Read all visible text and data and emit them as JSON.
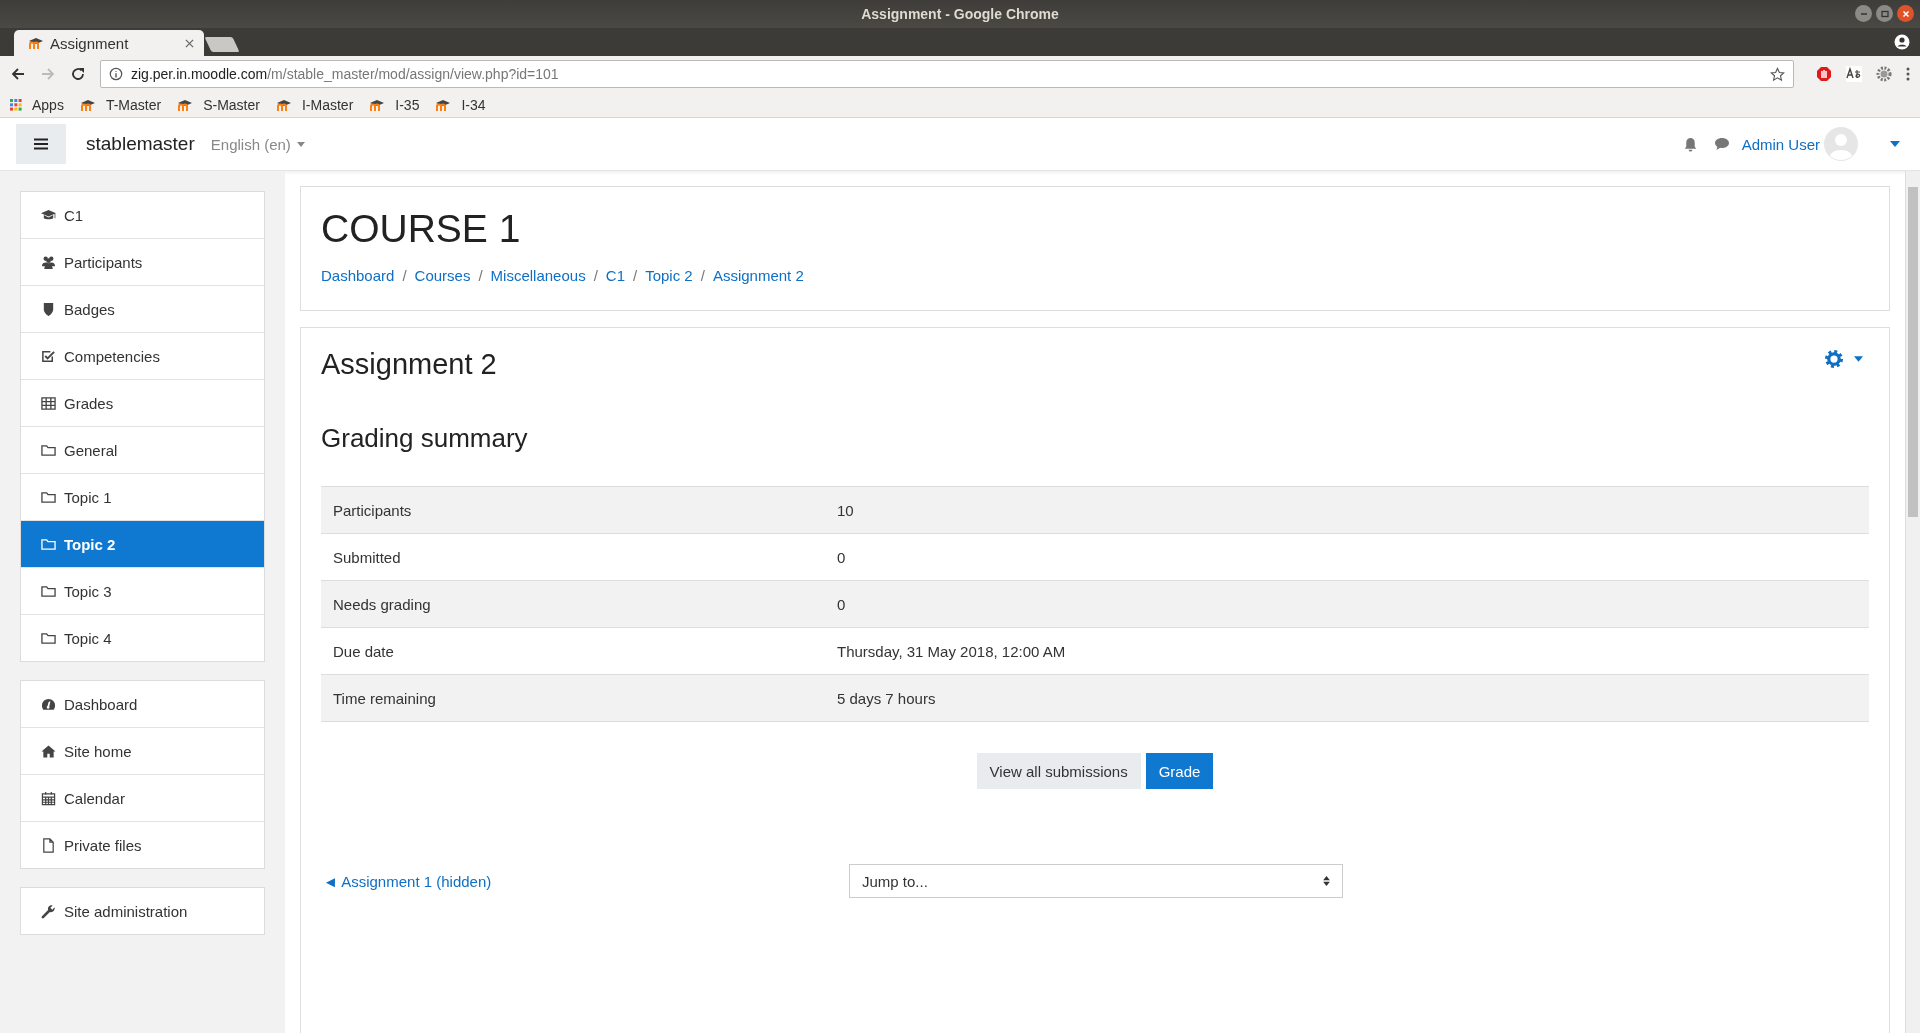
{
  "window": {
    "title": "Assignment - Google Chrome"
  },
  "browser_tabs": [
    {
      "label": "Assignment",
      "selected": true
    }
  ],
  "address_bar": {
    "host": "zig.per.in.moodle.com",
    "path": "/m/stable_master/mod/assign/view.php?id=101"
  },
  "bookmarks": [
    "Apps",
    "T-Master",
    "S-Master",
    "I-Master",
    "I-35",
    "I-34"
  ],
  "navbar": {
    "site_name": "stablemaster",
    "language": "English (en)",
    "user": "Admin User"
  },
  "sidebar": {
    "groups": [
      {
        "items": [
          {
            "label": "C1",
            "selected": false
          },
          {
            "label": "Participants",
            "selected": false
          },
          {
            "label": "Badges",
            "selected": false
          },
          {
            "label": "Competencies",
            "selected": false
          },
          {
            "label": "Grades",
            "selected": false
          },
          {
            "label": "General",
            "selected": false
          },
          {
            "label": "Topic 1",
            "selected": false
          },
          {
            "label": "Topic 2",
            "selected": true
          },
          {
            "label": "Topic 3",
            "selected": false
          },
          {
            "label": "Topic 4",
            "selected": false
          }
        ]
      },
      {
        "items": [
          {
            "label": "Dashboard",
            "selected": false
          },
          {
            "label": "Site home",
            "selected": false
          },
          {
            "label": "Calendar",
            "selected": false
          },
          {
            "label": "Private files",
            "selected": false
          }
        ]
      },
      {
        "items": [
          {
            "label": "Site administration",
            "selected": false
          }
        ]
      }
    ]
  },
  "header": {
    "title": "COURSE 1",
    "breadcrumb_separator": "/",
    "breadcrumb": [
      "Dashboard",
      "Courses",
      "Miscellaneous",
      "C1",
      "Topic 2",
      "Assignment 2"
    ]
  },
  "main": {
    "title": "Assignment 2",
    "section_title": "Grading summary",
    "table": {
      "rows": [
        {
          "label": "Participants",
          "value": "10"
        },
        {
          "label": "Submitted",
          "value": "0"
        },
        {
          "label": "Needs grading",
          "value": "0"
        },
        {
          "label": "Due date",
          "value": "Thursday, 31 May 2018, 12:00 AM"
        },
        {
          "label": "Time remaining",
          "value": "5 days 7 hours"
        }
      ]
    },
    "buttons": [
      {
        "label": "View all submissions",
        "kind": "secondary"
      },
      {
        "label": "Grade",
        "kind": "primary"
      }
    ],
    "previous_link": {
      "arrow": "◄",
      "label": "Assignment 1 (hidden)"
    },
    "jump_select": {
      "placeholder": "Jump to..."
    }
  }
}
